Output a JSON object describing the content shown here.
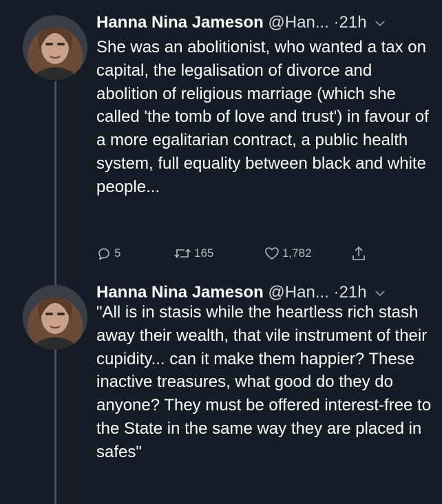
{
  "colors": {
    "background": "#141d26",
    "text": "#ffffff",
    "secondary_text": "#b3bac1",
    "thread_line": "#3d5466"
  },
  "tweets": [
    {
      "author_name": "Hanna Nina Jameson",
      "handle": "@Han...",
      "separator": "·",
      "time": "21h",
      "text": "She was an abolitionist, who wanted a tax on capital, the legalisation of divorce and abolition of religious marriage (which she called 'the tomb of love and trust') in favour of a more egalitarian contract, a public health system, full equality between black and white people...",
      "reply_count": "5",
      "retweet_count": "165",
      "like_count": "1,782",
      "icons": [
        "reply-icon",
        "retweet-icon",
        "like-icon",
        "share-icon",
        "chevron-down-icon"
      ]
    },
    {
      "author_name": "Hanna Nina Jameson",
      "handle": "@Han...",
      "separator": "·",
      "time": "21h",
      "text": "\"All is in stasis while the heartless rich stash away their wealth, that vile instrument of their cupidity... can it make them happier? These inactive treasures, what good do they do anyone? They must be offered interest-free to the State in the same way they are placed in safes\"",
      "icons": [
        "chevron-down-icon"
      ]
    }
  ]
}
